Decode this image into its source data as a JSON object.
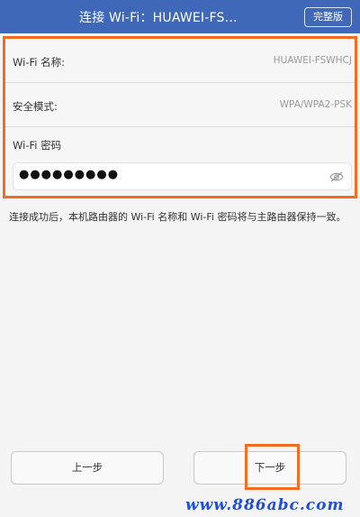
{
  "header": {
    "title": "连接 Wi-Fi：HUAWEI-FS…",
    "full_version_label": "完整版"
  },
  "form": {
    "wifi_name_label": "Wi-Fi 名称:",
    "wifi_name_value": "HUAWEI-FSWHCJ",
    "security_label": "安全模式:",
    "security_value": "WPA/WPA2-PSK",
    "password_label": "Wi-Fi 密码",
    "password_value": "●●●●●●●●●",
    "password_visibility_icon": "eye-icon"
  },
  "note": "连接成功后，本机路由器的 Wi-Fi 名称和 Wi-Fi 密码将与主路由器保持一致。",
  "buttons": {
    "prev_label": "上一步",
    "next_label": "下一步"
  },
  "watermark": "www.886abc.com",
  "colors": {
    "header_bg": "#3f68b8",
    "highlight": "#f26d21",
    "watermark": "#1e4fd6"
  }
}
